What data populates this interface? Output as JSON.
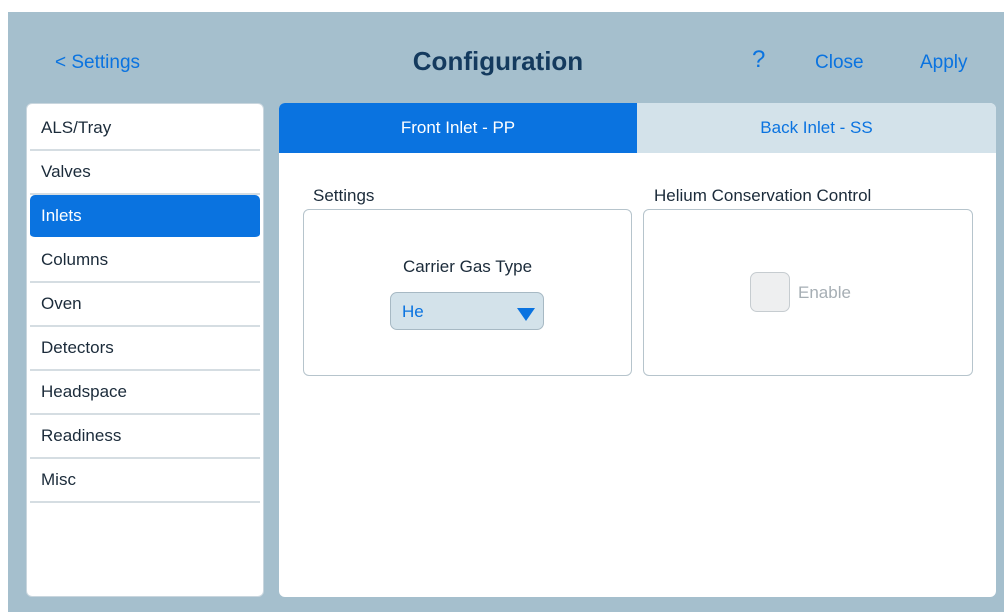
{
  "header": {
    "back_label": "< Settings",
    "title": "Configuration",
    "help_label": "?",
    "close_label": "Close",
    "apply_label": "Apply"
  },
  "sidebar": {
    "items": [
      {
        "label": "ALS/Tray"
      },
      {
        "label": "Valves"
      },
      {
        "label": "Inlets"
      },
      {
        "label": "Columns"
      },
      {
        "label": "Oven"
      },
      {
        "label": "Detectors"
      },
      {
        "label": "Headspace"
      },
      {
        "label": "Readiness"
      },
      {
        "label": "Misc"
      }
    ],
    "selected": "Inlets"
  },
  "tabs": [
    {
      "label": "Front Inlet - PP",
      "active": true
    },
    {
      "label": "Back Inlet - SS",
      "active": false
    }
  ],
  "settings_section": {
    "title": "Settings",
    "carrier_gas_label": "Carrier Gas Type",
    "carrier_gas_value": "He"
  },
  "helium_section": {
    "title": "Helium Conservation Control",
    "enable_label": "Enable",
    "enable_checked": false,
    "enable_disabled": true
  },
  "colors": {
    "accent": "#0a73e0",
    "background": "#a5bfcd",
    "title": "#143a5e",
    "tab_inactive": "#d3e2ea"
  },
  "icons": {
    "dropdown": "triangle-down-icon",
    "help": "question-mark-icon"
  }
}
